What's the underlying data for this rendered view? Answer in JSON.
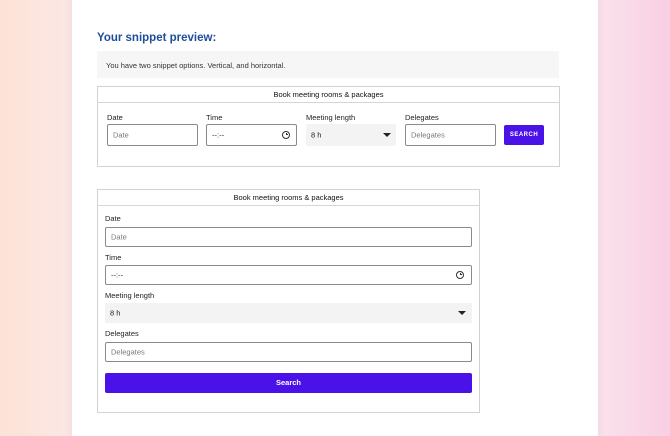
{
  "page": {
    "title": "Your snippet preview:",
    "info": "You have two snippet options. Vertical, and horizontal."
  },
  "horizontal_snippet": {
    "title": "Book meeting rooms & packages",
    "date_label": "Date",
    "date_placeholder": "Date",
    "time_label": "Time",
    "time_value": "--:--",
    "length_label": "Meeting length",
    "length_value": "8 h",
    "delegates_label": "Delegates",
    "delegates_placeholder": "Delegates",
    "search_label": "SEARCH"
  },
  "vertical_snippet": {
    "title": "Book meeting rooms & packages",
    "date_label": "Date",
    "date_placeholder": "Date",
    "time_label": "Time",
    "time_value": "--:--",
    "length_label": "Meeting length",
    "length_value": "8 h",
    "delegates_label": "Delegates",
    "delegates_placeholder": "Delegates",
    "search_label": "Search"
  },
  "colors": {
    "title": "#1e4f9a",
    "button": "#4a12e8"
  },
  "icons": [
    "clock-icon",
    "chevron-down-icon"
  ]
}
